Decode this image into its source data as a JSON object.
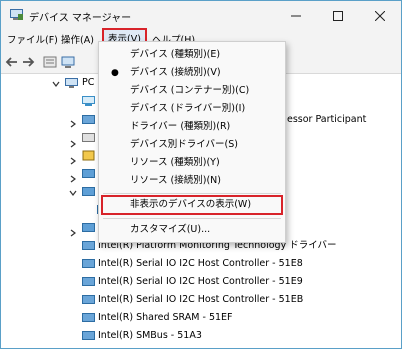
{
  "window": {
    "title": "デバイス マネージャー"
  },
  "menubar": {
    "file": "ファイル(F)",
    "action": "操作(A)",
    "view": "表示(V)",
    "help": "ヘルプ(H)"
  },
  "tree": {
    "root_label": "PC",
    "partial_label": "essor Participant",
    "rows": [
      "Intel(R) Platform Monitoring Technology ドライバー",
      "Intel(R) Serial IO I2C Host Controller - 51E8",
      "Intel(R) Serial IO I2C Host Controller - 51E9",
      "Intel(R) Serial IO I2C Host Controller - 51EB",
      "Intel(R) Shared SRAM - 51EF",
      "Intel(R) SMBus - 51A3"
    ]
  },
  "view_menu": {
    "items": [
      "デバイス (種類別)(E)",
      "デバイス (接続別)(V)",
      "デバイス (コンテナー別)(C)",
      "デバイス (ドライバー別)(I)",
      "ドライバー (種類別)(R)",
      "デバイス別ドライバー(S)",
      "リソース (種類別)(Y)",
      "リソース (接続別)(N)"
    ],
    "checked_index": 1,
    "show_hidden": "非表示のデバイスの表示(W)",
    "customize": "カスタマイズ(U)..."
  },
  "colors": {
    "highlight_border": "#d8232a",
    "window_border": "#5aa0c8"
  }
}
